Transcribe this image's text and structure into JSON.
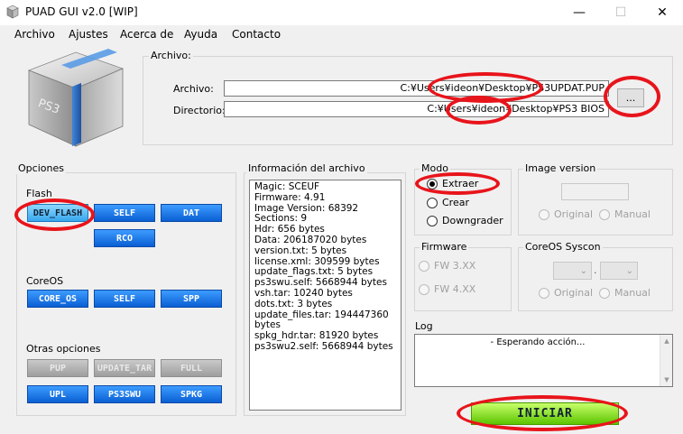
{
  "window": {
    "title": "PUAD GUI v2.0 [WIP]",
    "minimize": "—",
    "maximize": "☐",
    "close": "✕"
  },
  "menu": [
    "Archivo",
    "Ajustes",
    "Acerca de",
    "Ayuda",
    "Contacto"
  ],
  "file_group": {
    "label": "Archivo:",
    "archivo_label": "Archivo:",
    "archivo_value": "C:¥Users¥ideon¥Desktop¥PS3UPDAT.PUP",
    "directorio_label": "Directorio:",
    "directorio_value": "C:¥Users¥ideon¥Desktop¥PS3 BIOS",
    "browse_button": "..."
  },
  "opciones": {
    "label": "Opciones",
    "flash_label": "Flash",
    "flash_buttons": [
      "DEV_FLASH",
      "SELF",
      "DAT",
      "RCO"
    ],
    "coreos_label": "CoreOS",
    "coreos_buttons": [
      "CORE_OS",
      "SELF",
      "SPP"
    ],
    "otras_label": "Otras opciones",
    "otras_buttons_disabled": [
      "PUP",
      "UPDATE_TAR",
      "FULL"
    ],
    "otras_buttons": [
      "UPL",
      "PS3SWU",
      "SPKG"
    ]
  },
  "info": {
    "label": "Información del archivo",
    "lines": [
      "Magic: SCEUF",
      "Firmware: 4.91",
      "Image Version: 68392",
      "Sections: 9",
      "Hdr: 656 bytes",
      "Data: 206187020 bytes",
      "version.txt: 5 bytes",
      "license.xml: 309599 bytes",
      "update_flags.txt: 5 bytes",
      "ps3swu.self: 5668944 bytes",
      "vsh.tar: 10240 bytes",
      "dots.txt: 3 bytes",
      "update_files.tar: 194447360 bytes",
      "spkg_hdr.tar: 81920 bytes",
      "ps3swu2.self: 5668944 bytes"
    ]
  },
  "modo": {
    "label": "Modo",
    "options": [
      "Extraer",
      "Crear",
      "Downgrader"
    ],
    "selected": "Extraer"
  },
  "image_version": {
    "label": "Image version",
    "options": [
      "Original",
      "Manual"
    ]
  },
  "firmware": {
    "label": "Firmware",
    "options": [
      "FW 3.XX",
      "FW 4.XX"
    ]
  },
  "coreos_syscon": {
    "label": "CoreOS Syscon",
    "separator": ".",
    "options": [
      "Original",
      "Manual"
    ]
  },
  "log": {
    "label": "Log",
    "text": "- Esperando acción..."
  },
  "start_button": "INICIAR",
  "colors": {
    "highlight_ring": "#e8141b",
    "accent_blue": "#0a5fd3",
    "start_green": "#5cc400"
  }
}
